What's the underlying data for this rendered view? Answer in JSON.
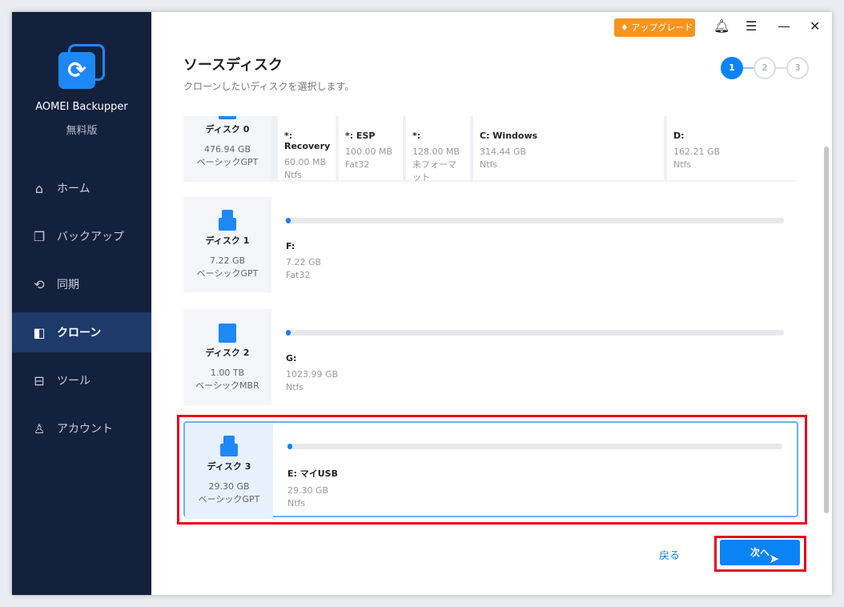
{
  "app": {
    "name": "AOMEI Backupper",
    "edition": "無料版"
  },
  "sidebar": {
    "items": [
      {
        "label": "ホーム",
        "icon": "home-icon"
      },
      {
        "label": "バックアップ",
        "icon": "backup-icon"
      },
      {
        "label": "同期",
        "icon": "sync-icon"
      },
      {
        "label": "クローン",
        "icon": "clone-icon",
        "active": true
      },
      {
        "label": "ツール",
        "icon": "tools-icon"
      },
      {
        "label": "アカウント",
        "icon": "account-icon"
      }
    ]
  },
  "header": {
    "upgrade": "アップグレード",
    "title": "ソースディスク",
    "subtitle": "クローンしたいディスクを選択します。",
    "steps": [
      "1",
      "2",
      "3"
    ],
    "current_step": 1
  },
  "disks": [
    {
      "name": "ディスク 0",
      "size": "476.94 GB",
      "type": "ベーシックGPT",
      "partitions": [
        {
          "name": "*: Recovery",
          "size": "60.00 MB",
          "fs": "Ntfs"
        },
        {
          "name": "*: ESP",
          "size": "100.00 MB",
          "fs": "Fat32"
        },
        {
          "name": "*:",
          "size": "128.00 MB",
          "fs": "未フォーマット"
        },
        {
          "name": "C: Windows",
          "size": "314.44 GB",
          "fs": "Ntfs"
        },
        {
          "name": "D:",
          "size": "162.21 GB",
          "fs": "Ntfs"
        }
      ]
    },
    {
      "name": "ディスク 1",
      "size": "7.22 GB",
      "type": "ベーシックGPT",
      "partitions": [
        {
          "name": "F:",
          "size": "7.22 GB",
          "fs": "Fat32",
          "used": 0.01
        }
      ]
    },
    {
      "name": "ディスク 2",
      "size": "1.00 TB",
      "type": "ベーシックMBR",
      "partitions": [
        {
          "name": "G:",
          "size": "1023.99 GB",
          "fs": "Ntfs",
          "used": 0.01
        }
      ]
    },
    {
      "name": "ディスク 3",
      "size": "29.30 GB",
      "type": "ベーシックGPT",
      "selected": true,
      "partitions": [
        {
          "name": "E: マイUSB",
          "size": "29.30 GB",
          "fs": "Ntfs",
          "used": 0.01
        }
      ]
    }
  ],
  "footer": {
    "back": "戻る",
    "next": "次へ"
  }
}
